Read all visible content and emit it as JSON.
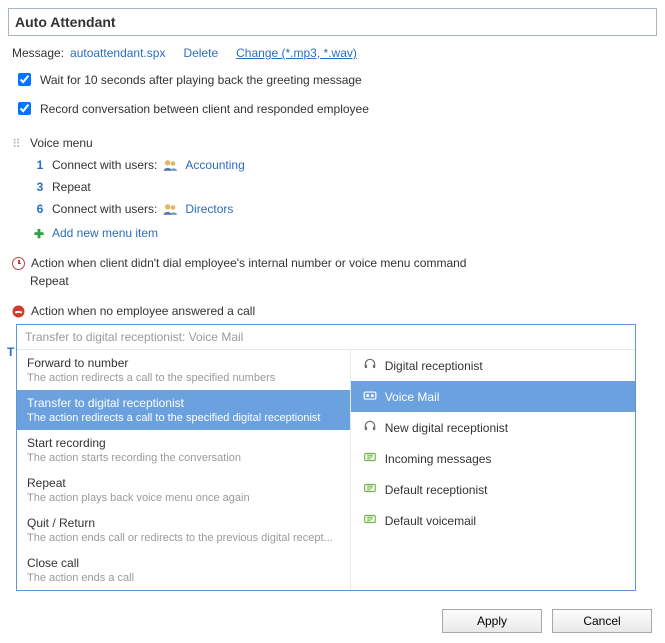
{
  "title": "Auto Attendant",
  "message": {
    "label": "Message:",
    "file": "autoattendant.spx",
    "delete": "Delete",
    "change": "Change (*.mp3, *.wav)"
  },
  "options": {
    "wait": "Wait for 10 seconds after playing back the greeting message",
    "record": "Record conversation between client and responded employee"
  },
  "voicemenu": {
    "title": "Voice menu",
    "items": [
      {
        "num": "1",
        "prefix": "Connect with users:",
        "group": "Accounting",
        "has_group": true
      },
      {
        "num": "3",
        "prefix": "Repeat",
        "group": "",
        "has_group": false
      },
      {
        "num": "6",
        "prefix": "Connect with users:",
        "group": "Directors",
        "has_group": true
      }
    ],
    "add": "Add new menu item"
  },
  "action1": {
    "title": "Action when client didn't dial employee's internal number or voice menu command",
    "value": "Repeat"
  },
  "action2": {
    "title": "Action when no employee answered a call"
  },
  "dropdown": {
    "header": "Transfer to digital receptionist: Voice Mail",
    "left": [
      {
        "title": "Forward to number",
        "desc": "The action redirects a call to the specified numbers",
        "selected": false
      },
      {
        "title": "Transfer to digital receptionist",
        "desc": "The action redirects a call to the specified digital receptionist",
        "selected": true
      },
      {
        "title": "Start recording",
        "desc": "The action starts recording the conversation",
        "selected": false
      },
      {
        "title": "Repeat",
        "desc": "The action plays back voice menu once again",
        "selected": false
      },
      {
        "title": "Quit / Return",
        "desc": "The action ends call or redirects to the previous digital recept...",
        "selected": false
      },
      {
        "title": "Close call",
        "desc": "The action ends a call",
        "selected": false
      }
    ],
    "right": [
      {
        "title": "Digital receptionist",
        "icon": "headset",
        "selected": false
      },
      {
        "title": "Voice Mail",
        "icon": "voicemail",
        "selected": true
      },
      {
        "title": "New digital receptionist",
        "icon": "headset",
        "selected": false
      },
      {
        "title": "Incoming messages",
        "icon": "queue",
        "selected": false
      },
      {
        "title": "Default receptionist",
        "icon": "queue",
        "selected": false
      },
      {
        "title": "Default voicemail",
        "icon": "queue",
        "selected": false
      }
    ]
  },
  "t_anchor": "T",
  "buttons": {
    "apply": "Apply",
    "cancel": "Cancel"
  }
}
